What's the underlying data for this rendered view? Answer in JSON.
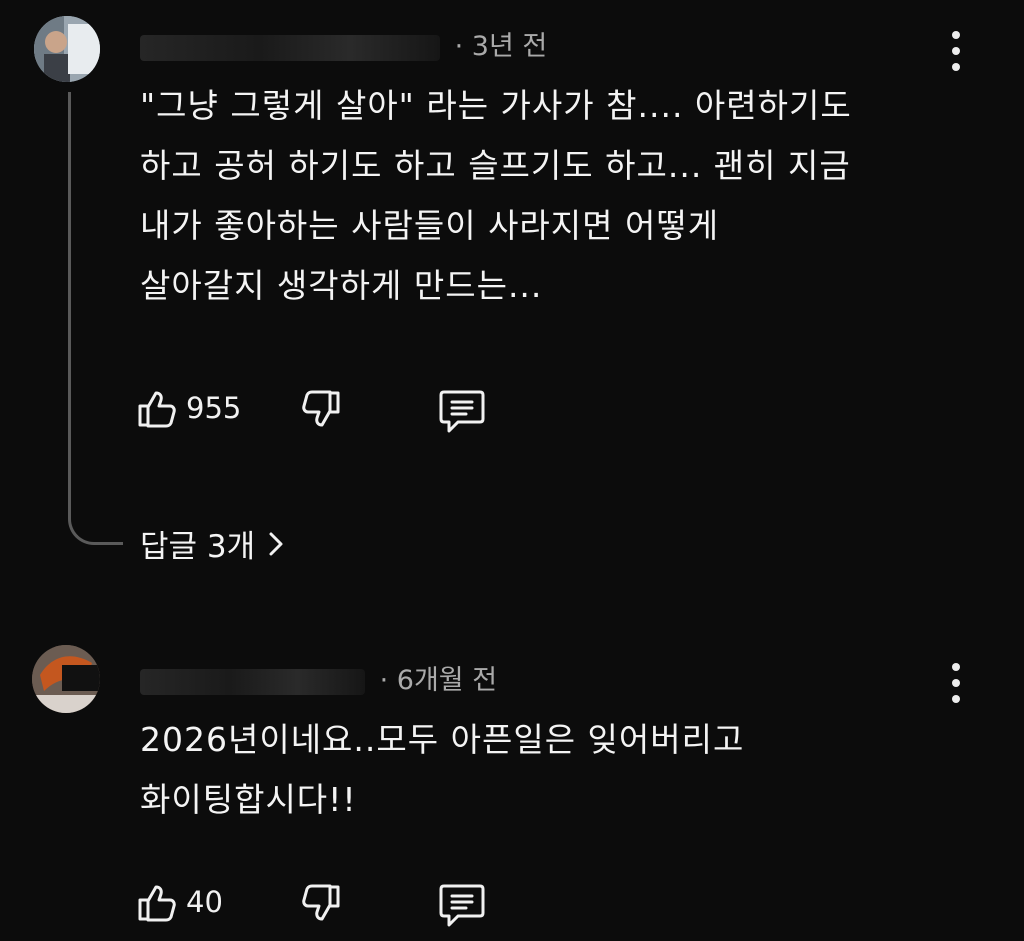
{
  "comments": [
    {
      "time": "3년 전",
      "lines": [
        "\"그냥 그렇게 살아\" 라는 가사가 참.... 아련하기도",
        "하고 공허 하기도 하고 슬프기도 하고... 괜히 지금",
        "내가 좋아하는 사람들이 사라지면 어떻게",
        "살아갈지 생각하게 만드는..."
      ],
      "likes": "955",
      "replies_label": "답글 3개"
    },
    {
      "time": "6개월 전",
      "lines": [
        "2026년이네요..모두 아픈일은 잊어버리고",
        "화이팅합시다!!"
      ],
      "likes": "40"
    }
  ],
  "icons": {
    "like": "thumbs-up-icon",
    "dislike": "thumbs-down-icon",
    "reply": "comment-icon",
    "menu": "more-vert-icon",
    "chevron": "chevron-right-icon"
  },
  "colors": {
    "background": "#0c0c0c",
    "text": "#f1f1f1",
    "meta": "#aaaaaa"
  }
}
